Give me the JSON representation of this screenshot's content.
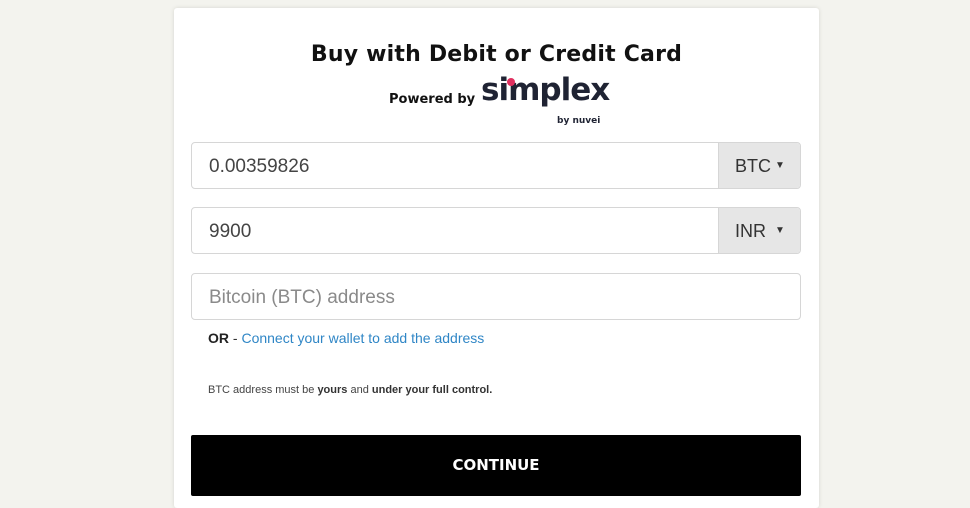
{
  "header": {
    "title": "Buy with Debit or Credit Card",
    "powered_by": "Powered by",
    "brand_name": "simplex",
    "brand_sub_by": "by",
    "brand_sub_name": "nuvei",
    "brand_accent": "#e0305f"
  },
  "crypto_amount": {
    "value": "0.00359826",
    "currency": "BTC"
  },
  "fiat_amount": {
    "value": "9900",
    "currency": "INR"
  },
  "address": {
    "placeholder": "Bitcoin (BTC) address"
  },
  "wallet": {
    "or_label": "OR",
    "separator": "-",
    "link_text": "Connect your wallet to add the address",
    "link_color": "#2f86c6"
  },
  "note": {
    "part1": "BTC address must be",
    "part2": "yours",
    "part3": "and",
    "part4": "under your full control."
  },
  "actions": {
    "continue_label": "CONTINUE"
  }
}
